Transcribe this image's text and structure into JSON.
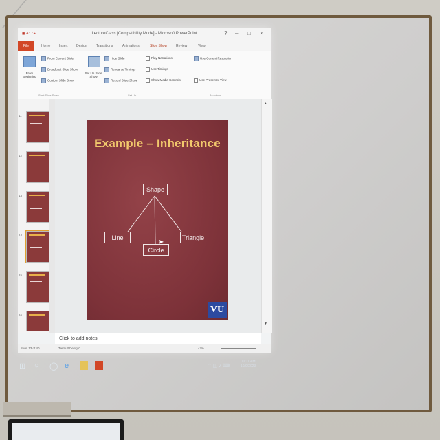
{
  "window": {
    "title": "LectureClass [Compatibility Mode] - Microsoft PowerPoint",
    "controls": [
      "?",
      "–",
      "□",
      "×"
    ]
  },
  "ribbon_tabs": [
    "File",
    "Home",
    "Insert",
    "Design",
    "Transitions",
    "Animations",
    "Slide Show",
    "Review",
    "View"
  ],
  "ribbon": {
    "start_group": {
      "from_beginning": "From Beginning",
      "from_current": "From Current Slide",
      "broadcast": "Broadcast Slide Show",
      "custom": "Custom Slide Show",
      "label": "Start Slide Show"
    },
    "setup_group": {
      "set_up": "Set Up Slide Show",
      "hide_slide": "Hide Slide",
      "rehearse": "Rehearse Timings",
      "record": "Record Slide Show",
      "play_narrations": "Play Narrations",
      "use_timings": "Use Timings",
      "show_media": "Show Media Controls",
      "label": "Set Up"
    },
    "monitors_group": {
      "resolution": "Use Current Resolution",
      "presenter_view": "Use Presenter View",
      "label": "Monitors"
    }
  },
  "thumbnails": [
    {
      "num": "11"
    },
    {
      "num": "12"
    },
    {
      "num": "13"
    },
    {
      "num": "14"
    },
    {
      "num": "15"
    },
    {
      "num": "16"
    }
  ],
  "slide": {
    "title": "Example – Inheritance",
    "nodes": {
      "shape": "Shape",
      "line": "Line",
      "circle": "Circle",
      "triangle": "Triangle"
    },
    "logo": "VU"
  },
  "notes_placeholder": "Click to add notes",
  "status": {
    "slide_info": "Slide 13 of 40",
    "design": "\"Default Design\"",
    "zoom": "47%"
  },
  "taskbar": {
    "time": "10:11 AM",
    "date": "10/9/2023"
  }
}
